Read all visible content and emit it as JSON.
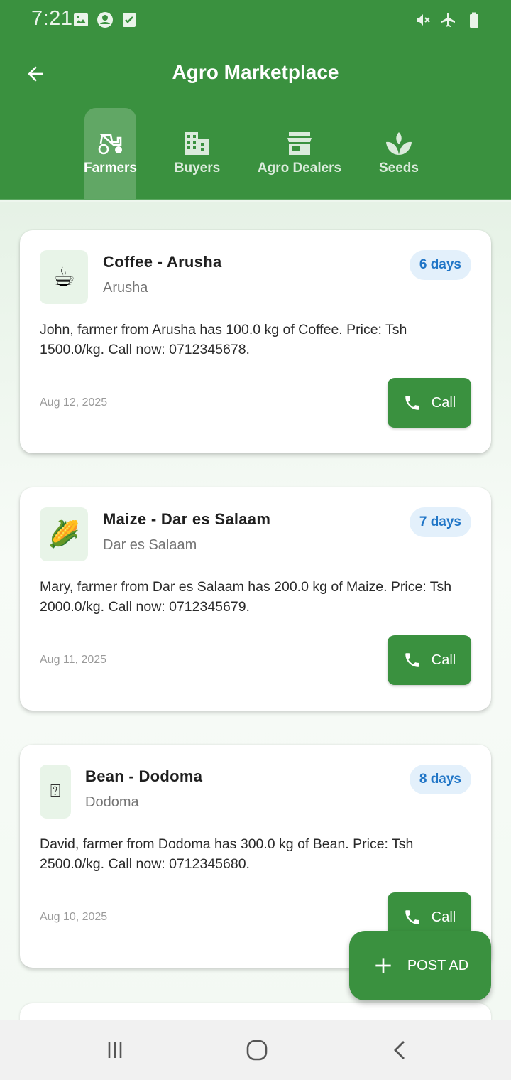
{
  "status_bar": {
    "time": "7:21",
    "left_icons": [
      "image-icon",
      "account-circle-icon",
      "checkbox-icon"
    ],
    "right_icons": [
      "mute-icon",
      "airplane-icon",
      "battery-icon"
    ]
  },
  "appbar": {
    "title": "Agro Marketplace",
    "back_icon": "arrow-back-icon"
  },
  "tabs": [
    {
      "label": "Farmers",
      "icon": "tractor-icon",
      "active": true
    },
    {
      "label": "Buyers",
      "icon": "building-icon",
      "active": false
    },
    {
      "label": "Agro Dealers",
      "icon": "store-icon",
      "active": false
    },
    {
      "label": "Seeds",
      "icon": "sprout-icon",
      "active": false
    }
  ],
  "listings": [
    {
      "thumb": "☕",
      "title": "Coffee - Arusha",
      "location": "Arusha",
      "badge": "6 days",
      "description": "John, farmer from Arusha has 100.0 kg of Coffee. Price: Tsh 1500.0/kg. Call now: 0712345678.",
      "date": "Aug 12, 2025",
      "call_label": "Call"
    },
    {
      "thumb": "🌽",
      "title": "Maize - Dar es Salaam",
      "location": "Dar es Salaam",
      "badge": "7 days",
      "description": "Mary, farmer from Dar es Salaam has 200.0 kg of Maize. Price: Tsh 2000.0/kg. Call now: 0712345679.",
      "date": "Aug 11, 2025",
      "call_label": "Call"
    },
    {
      "thumb": "⍰",
      "title": "Bean - Dodoma",
      "location": "Dodoma",
      "badge": "8 days",
      "description": "David, farmer from Dodoma has 300.0 kg of Bean. Price: Tsh 2500.0/kg. Call now: 0712345680.",
      "date": "Aug 10, 2025",
      "call_label": "Call"
    }
  ],
  "fab": {
    "label": "POST AD",
    "icon": "plus-icon"
  },
  "colors": {
    "primary": "#3a913f",
    "badge_bg": "#e3f0fb",
    "badge_text": "#2176c7"
  }
}
